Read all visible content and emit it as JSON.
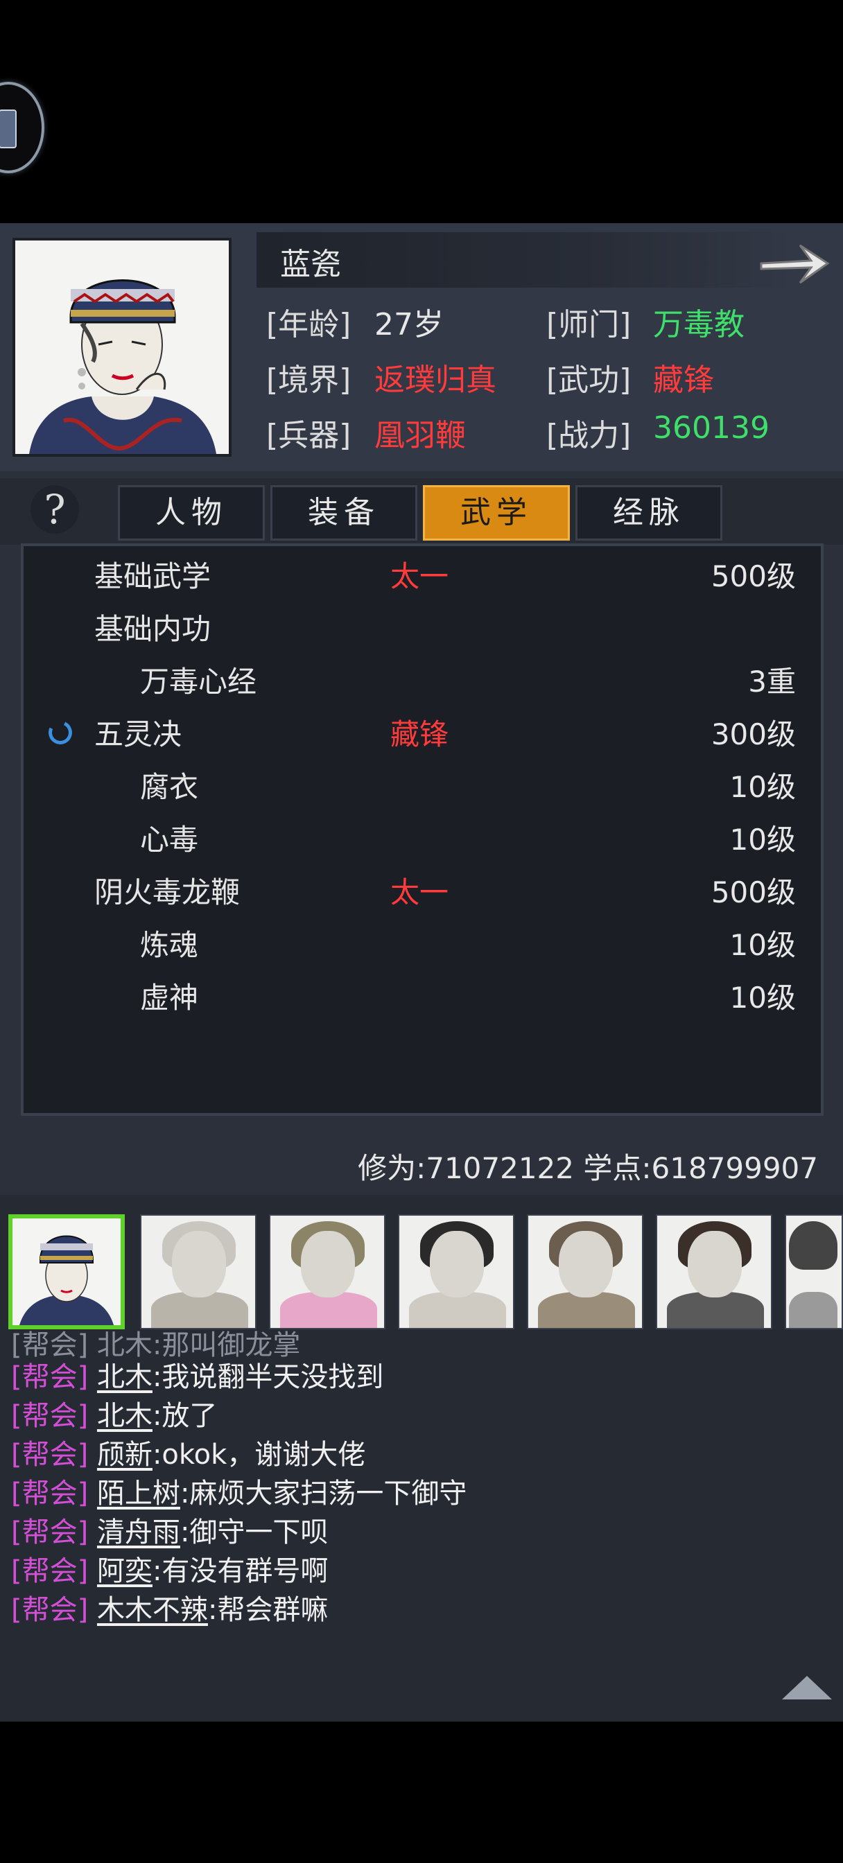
{
  "character": {
    "name": "蓝瓷",
    "fields": [
      {
        "label": "[年龄]",
        "value": "27岁",
        "color": "white"
      },
      {
        "label": "[师门]",
        "value": "万毒教",
        "color": "green"
      },
      {
        "label": "[境界]",
        "value": "返璞归真",
        "color": "red"
      },
      {
        "label": "[武功]",
        "value": "藏锋",
        "color": "red"
      },
      {
        "label": "[兵器]",
        "value": "凰羽鞭",
        "color": "red"
      },
      {
        "label": "[战力]",
        "value": "360139",
        "color": "green"
      }
    ]
  },
  "tabs": [
    {
      "label": "人物",
      "active": false
    },
    {
      "label": "装备",
      "active": false
    },
    {
      "label": "武学",
      "active": true
    },
    {
      "label": "经脉",
      "active": false
    }
  ],
  "skills": [
    {
      "name": "基础武学",
      "rank": "太一",
      "level": "500级",
      "indent": false
    },
    {
      "name": "基础内功",
      "rank": "",
      "level": "",
      "indent": false
    },
    {
      "name": "万毒心经",
      "rank": "",
      "level": "3重",
      "indent": true
    },
    {
      "name": "五灵决",
      "rank": "藏锋",
      "level": "300级",
      "indent": false,
      "active": true
    },
    {
      "name": "腐衣",
      "rank": "",
      "level": "10级",
      "indent": true
    },
    {
      "name": "心毒",
      "rank": "",
      "level": "10级",
      "indent": true
    },
    {
      "name": "阴火毒龙鞭",
      "rank": "太一",
      "level": "500级",
      "indent": false
    },
    {
      "name": "炼魂",
      "rank": "",
      "level": "10级",
      "indent": true
    },
    {
      "name": "虚神",
      "rank": "",
      "level": "10级",
      "indent": true
    }
  ],
  "stats": {
    "text": "修为:71072122  学点:618799907"
  },
  "chat": {
    "partial_top": "[帮会] 北木:那叫御龙掌",
    "messages": [
      {
        "tag": "[帮会]",
        "user": "北木",
        "text": ":我说翻半天没找到"
      },
      {
        "tag": "[帮会]",
        "user": "北木",
        "text": ":放了"
      },
      {
        "tag": "[帮会]",
        "user": "颀新",
        "text": ":okok，谢谢大佬"
      },
      {
        "tag": "[帮会]",
        "user": "陌上树",
        "text": ":麻烦大家扫荡一下御守"
      },
      {
        "tag": "[帮会]",
        "user": "清舟雨",
        "text": ":御守一下呗"
      },
      {
        "tag": "[帮会]",
        "user": "阿奕",
        "text": ":有没有群号啊"
      },
      {
        "tag": "[帮会]",
        "user": "木木不辣",
        "text": ":帮会群嘛"
      }
    ]
  },
  "colors": {
    "accent_tab": "#d98a12",
    "rank_red": "#ff3b3b",
    "value_green": "#3fe06a",
    "guild_tag": "#d24fd6",
    "selected_border": "#5fd12a"
  }
}
